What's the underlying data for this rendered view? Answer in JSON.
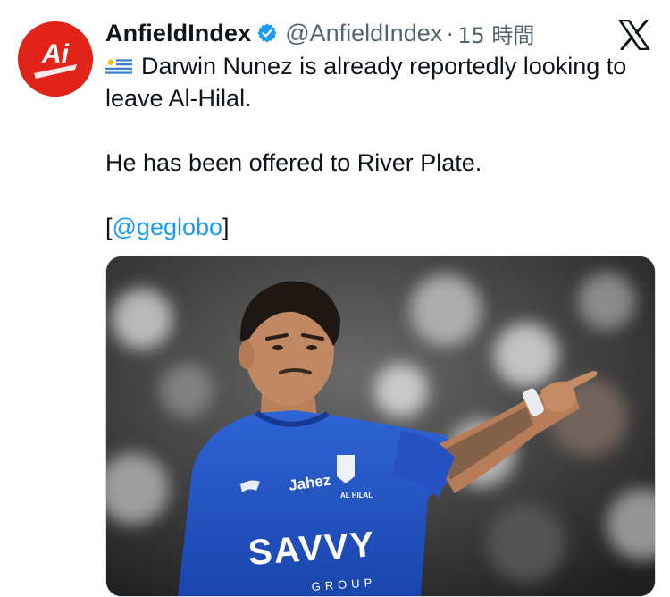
{
  "tweet": {
    "avatar_text": "Ai",
    "display_name": "AnfieldIndex",
    "handle": "@AnfieldIndex",
    "separator": "·",
    "time": "15 時間",
    "verified": true,
    "platform_icon": "x-logo-icon",
    "flag_icon": "uruguay-flag-icon",
    "line1": "Darwin Nunez is already reportedly looking to leave Al-Hilal.",
    "line2": "He has been offered to River Plate.",
    "line3_open": "[",
    "mention": "@geglobo",
    "line3_close": "]"
  },
  "media": {
    "jersey_texts": [
      "Jahez",
      "SAVVY",
      "GROUP",
      "AL HILAL"
    ],
    "brand_colors": {
      "jersey_blue": "#1f4fbf",
      "badge_red": "#e2231a",
      "link_blue": "#1d9bf0",
      "verified_blue": "#1d9bf0"
    }
  }
}
